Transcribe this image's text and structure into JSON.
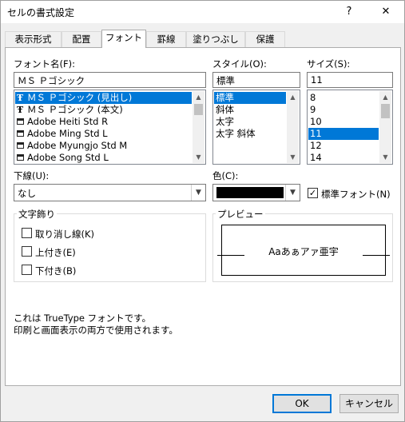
{
  "window": {
    "title": "セルの書式設定",
    "help_label": "?",
    "close_label": "✕"
  },
  "tabs": [
    {
      "label": "表示形式"
    },
    {
      "label": "配置"
    },
    {
      "label": "フォント"
    },
    {
      "label": "罫線"
    },
    {
      "label": "塗りつぶし"
    },
    {
      "label": "保護"
    }
  ],
  "font": {
    "label": "フォント名(F):",
    "value": "ＭＳ Ｐゴシック",
    "items": [
      {
        "label": "ＭＳ Ｐゴシック (見出し)",
        "icon": "truetype-icon"
      },
      {
        "label": "ＭＳ Ｐゴシック (本文)",
        "icon": "truetype-icon"
      },
      {
        "label": "Adobe Heiti Std R",
        "icon": "printer-font-icon"
      },
      {
        "label": "Adobe Ming Std L",
        "icon": "printer-font-icon"
      },
      {
        "label": "Adobe Myungjo Std M",
        "icon": "printer-font-icon"
      },
      {
        "label": "Adobe Song Std L",
        "icon": "printer-font-icon"
      }
    ],
    "selected_index": 0
  },
  "style": {
    "label": "スタイル(O):",
    "value": "標準",
    "items": [
      {
        "label": "標準"
      },
      {
        "label": "斜体"
      },
      {
        "label": "太字"
      },
      {
        "label": "太字 斜体"
      }
    ],
    "selected_index": 0
  },
  "size": {
    "label": "サイズ(S):",
    "value": "11",
    "items": [
      {
        "label": "8"
      },
      {
        "label": "9"
      },
      {
        "label": "10"
      },
      {
        "label": "11"
      },
      {
        "label": "12"
      },
      {
        "label": "14"
      }
    ],
    "selected_index": 3
  },
  "underline": {
    "label": "下線(U):",
    "value": "なし"
  },
  "color": {
    "label": "色(C):",
    "value": "#000000"
  },
  "normal_font": {
    "label": "標準フォント(N)",
    "checked": true,
    "check_mark": "✓"
  },
  "effects": {
    "title": "文字飾り",
    "items": [
      {
        "label": "取り消し線(K)",
        "checked": false
      },
      {
        "label": "上付き(E)",
        "checked": false
      },
      {
        "label": "下付き(B)",
        "checked": false
      }
    ]
  },
  "preview": {
    "title": "プレビュー",
    "sample": "Aaあぁアァ亜宇"
  },
  "description": {
    "line1": "これは TrueType フォントです。",
    "line2": "印刷と画面表示の両方で使用されます。"
  },
  "buttons": {
    "ok": "OK",
    "cancel": "キャンセル"
  },
  "colors": {
    "accent": "#0078d7",
    "dialog_bg": "#f0f0f0"
  }
}
